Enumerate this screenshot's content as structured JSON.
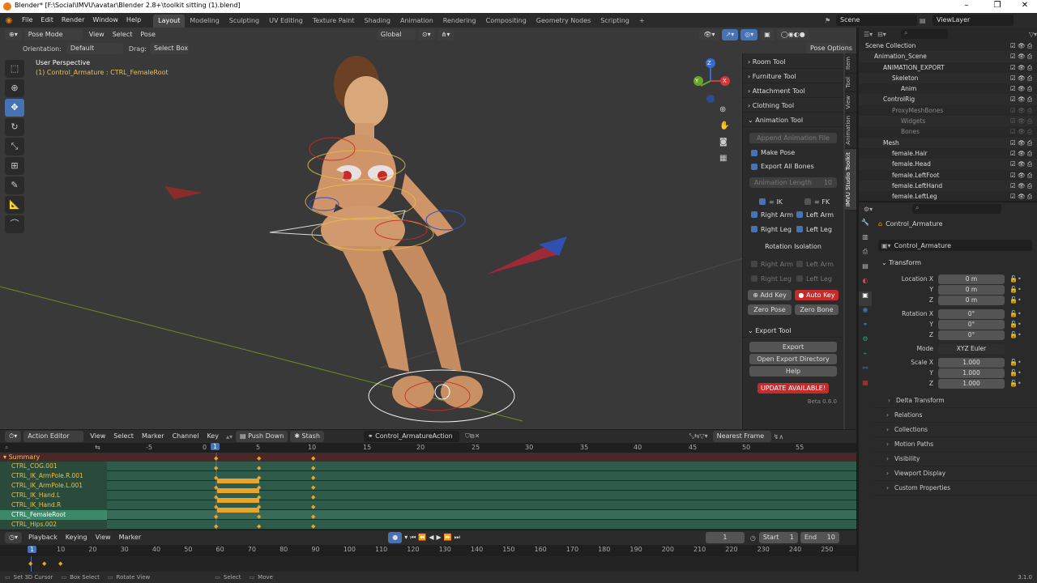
{
  "window": {
    "title": "Blender* [F:\\Social\\IMVU\\avatar\\Blender 2.8+\\toolkit sitting (1).blend]",
    "controls": [
      "–",
      "❐",
      "✕"
    ]
  },
  "menu": {
    "items": [
      "File",
      "Edit",
      "Render",
      "Window",
      "Help"
    ],
    "workspaces": [
      "Layout",
      "Modeling",
      "Sculpting",
      "UV Editing",
      "Texture Paint",
      "Shading",
      "Animation",
      "Rendering",
      "Compositing",
      "Geometry Nodes",
      "Scripting"
    ],
    "add_ws": "+",
    "scene": "Scene",
    "view_layer": "ViewLayer"
  },
  "viewport": {
    "mode": "Pose Mode",
    "menus": [
      "View",
      "Select",
      "Pose"
    ],
    "transform": "Global",
    "orientation_label": "Orientation:",
    "orientation": "Default",
    "drag_label": "Drag:",
    "drag": "Select Box",
    "pose_options": "Pose Options",
    "perspective": "User Perspective",
    "active": "(1) Control_Armature : CTRL_FemaleRoot",
    "axis_x": "X",
    "axis_y": "Y",
    "axis_z": "Z"
  },
  "toolkit": {
    "sections": [
      "Room Tool",
      "Furniture Tool",
      "Attachment Tool",
      "Clothing Tool",
      "Animation Tool"
    ],
    "append_anim": "Append Animation File",
    "make_pose": "Make Pose",
    "export_all": "Export All Bones",
    "anim_length_label": "Animation Length",
    "anim_length": "10",
    "ik": "= IK",
    "fk": "= FK",
    "right_arm": "Right Arm",
    "left_arm": "Left Arm",
    "right_leg": "Right Leg",
    "left_leg": "Left Leg",
    "rotation_isolation": "Rotation Isolation",
    "add_key": "Add Key",
    "auto_key": "Auto Key",
    "zero_pose": "Zero Pose",
    "zero_bone": "Zero Bone",
    "export_tool": "Export Tool",
    "export": "Export",
    "open_export_dir": "Open Export Directory",
    "help": "Help",
    "update": "UPDATE AVAILABLE!",
    "version": "Beta 0.6.0"
  },
  "vtabs": [
    "Item",
    "Tool",
    "View",
    "Animation",
    "IMVU Studio Toolkit"
  ],
  "outliner": {
    "rows": [
      {
        "label": "Scene Collection",
        "indent": 0,
        "dim": false
      },
      {
        "label": "Animation_Scene",
        "indent": 1,
        "dim": false
      },
      {
        "label": "ANIMATION_EXPORT",
        "indent": 2,
        "dim": false
      },
      {
        "label": "Skeleton",
        "indent": 3,
        "dim": false
      },
      {
        "label": "Anim",
        "indent": 4,
        "dim": false
      },
      {
        "label": "ControlRig",
        "indent": 2,
        "dim": false
      },
      {
        "label": "ProxyMeshBones",
        "indent": 3,
        "dim": true
      },
      {
        "label": "Widgets",
        "indent": 4,
        "dim": true
      },
      {
        "label": "Bones",
        "indent": 4,
        "dim": true
      },
      {
        "label": "Mesh",
        "indent": 2,
        "dim": false
      },
      {
        "label": "female.Hair",
        "indent": 3,
        "dim": false
      },
      {
        "label": "female.Head",
        "indent": 3,
        "dim": false
      },
      {
        "label": "female.LeftFoot",
        "indent": 3,
        "dim": false
      },
      {
        "label": "female.LeftHand",
        "indent": 3,
        "dim": false
      },
      {
        "label": "female.LeftLeg",
        "indent": 3,
        "dim": false
      }
    ]
  },
  "properties": {
    "object": "Control_Armature",
    "datablock": "Control_Armature",
    "transform": "Transform",
    "location_label": "Location X",
    "location": [
      "0 m",
      "0 m",
      "0 m"
    ],
    "rotation_label": "Rotation X",
    "rotation": [
      "0°",
      "0°",
      "0°"
    ],
    "mode_label": "Mode",
    "mode": "XYZ Euler",
    "scale_label": "Scale X",
    "scale": [
      "1.000",
      "1.000",
      "1.000"
    ],
    "axis_y": "Y",
    "axis_z": "Z",
    "sections": [
      "Delta Transform",
      "Relations",
      "Collections",
      "Motion Paths",
      "Visibility",
      "Viewport Display",
      "Custom Properties"
    ]
  },
  "action_editor": {
    "mode": "Action Editor",
    "menus": [
      "View",
      "Select",
      "Marker",
      "Channel",
      "Key"
    ],
    "push_down": "Push Down",
    "stash": "Stash",
    "action": "Control_ArmatureAction",
    "snap": "Nearest Frame",
    "ruler": [
      "-5",
      "0",
      "1",
      "5",
      "10",
      "15",
      "20",
      "25",
      "30",
      "35",
      "40",
      "45",
      "50",
      "55"
    ],
    "summary": "Summary",
    "channels": [
      "CTRL_COG.001",
      "CTRL_IK_ArmPole.R.001",
      "CTRL_IK_ArmPole.L.001",
      "CTRL_IK_Hand.L",
      "CTRL_IK_Hand.R",
      "CTRL_FemaleRoot",
      "CTRL_Hips.002"
    ]
  },
  "timeline": {
    "menus": [
      "Playback",
      "Keying",
      "View",
      "Marker"
    ],
    "current_frame": "1",
    "start_label": "Start",
    "start": "1",
    "end_label": "End",
    "end": "10",
    "ruler": [
      "1",
      "10",
      "20",
      "30",
      "40",
      "50",
      "60",
      "70",
      "80",
      "90",
      "100",
      "110",
      "120",
      "130",
      "140",
      "150",
      "160",
      "170",
      "180",
      "190",
      "200",
      "210",
      "220",
      "230",
      "240",
      "250"
    ]
  },
  "status": {
    "items": [
      "Set 3D Cursor",
      "Box Select",
      "Rotate View",
      "Select",
      "Move"
    ],
    "version": "3.1.0"
  },
  "colors": {
    "accent": "#4772b3",
    "keyframe": "#e8a52a",
    "channel": "#2f5b4a",
    "selected_channel": "#3a8a6a",
    "update": "#c62b2b"
  }
}
